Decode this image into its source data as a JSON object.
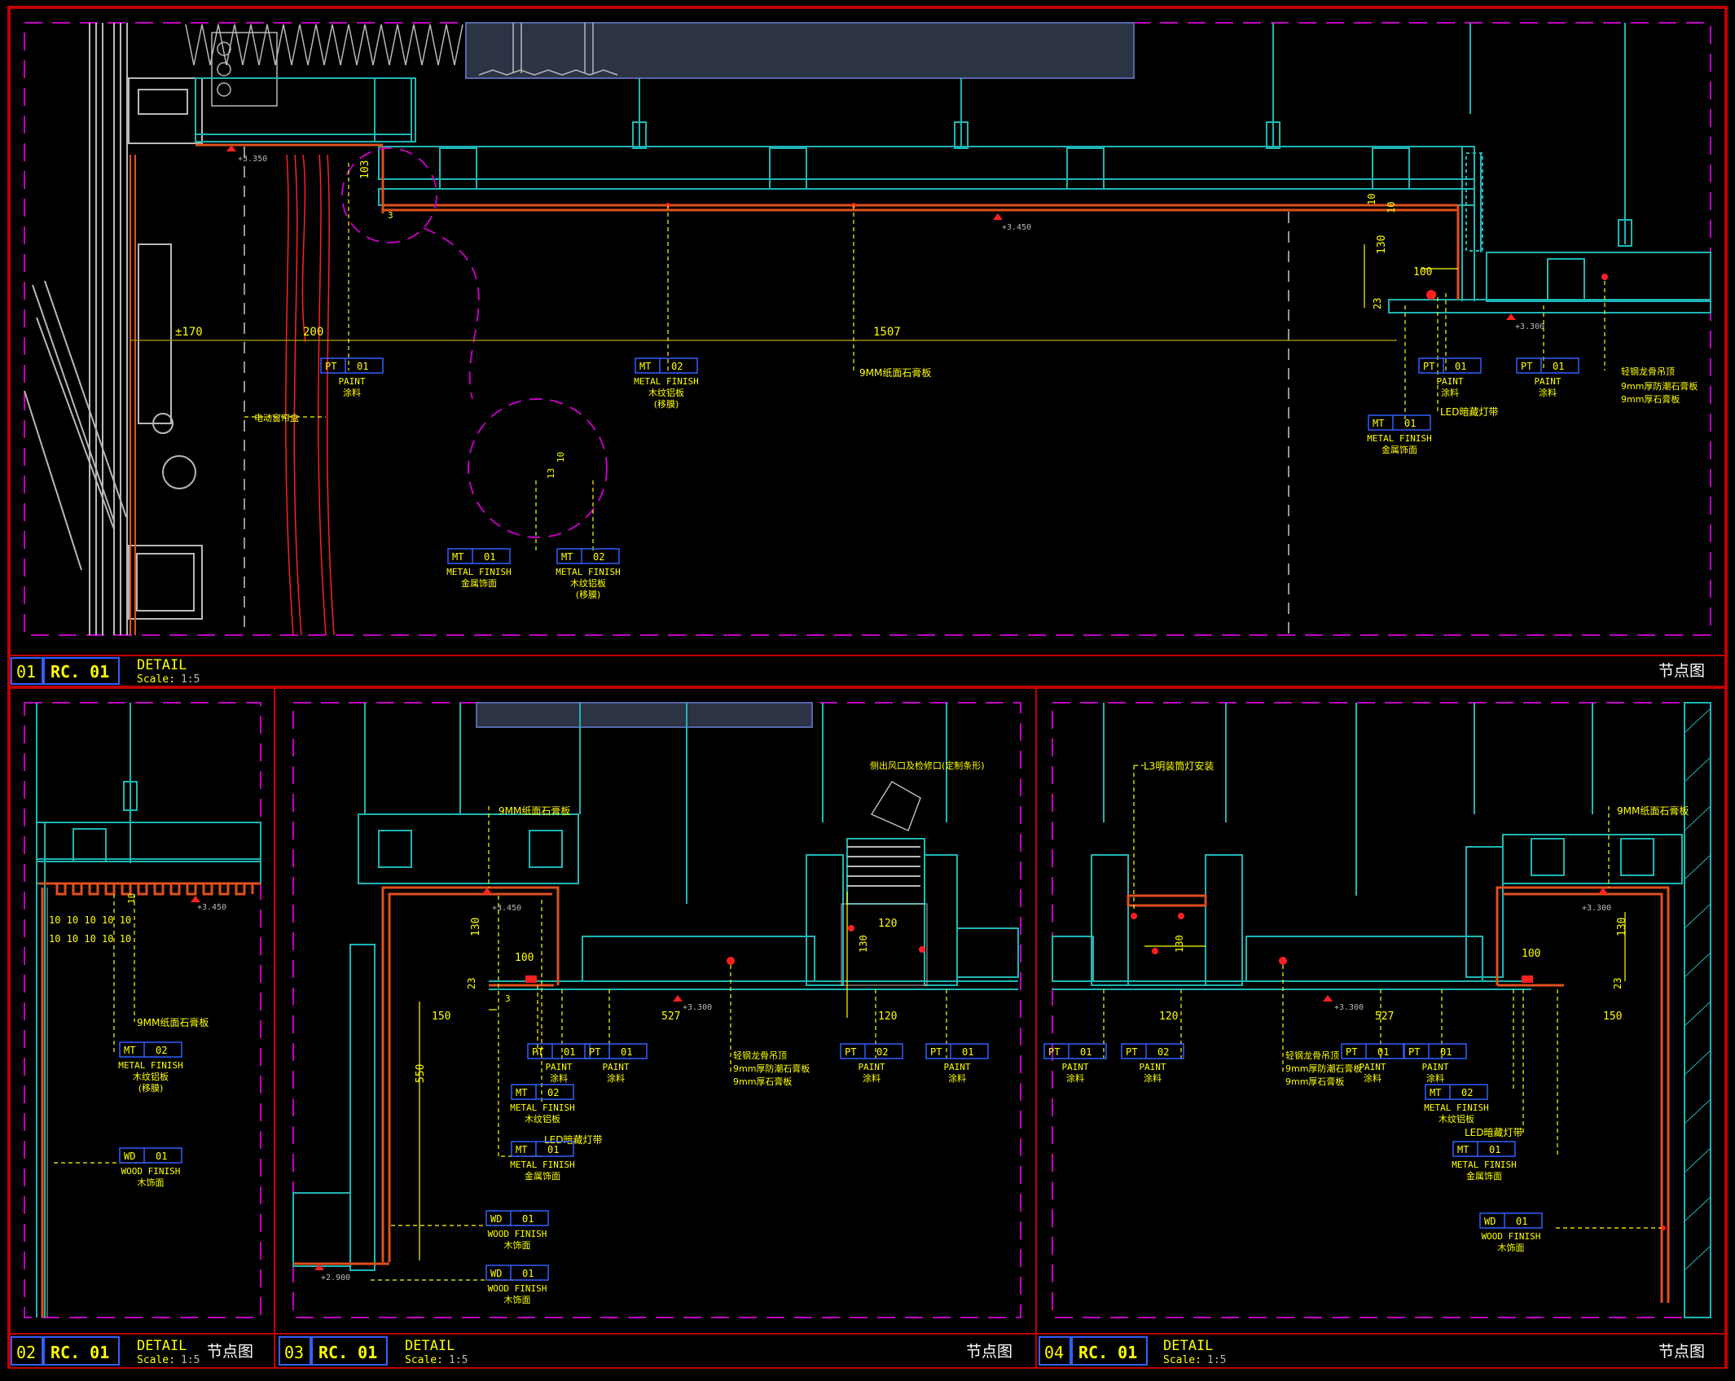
{
  "colors": {
    "background": "#000000",
    "frame": "#c00000",
    "viewport": "#c000c0",
    "structure": "#1fb5b5",
    "annotation": "#ffff00",
    "finish": "#e0501c",
    "marker": "#ff2020",
    "tag_box": "#3060ff",
    "gray": "#b8b8b8",
    "duct": "#2b3345"
  },
  "details": [
    {
      "number": "01",
      "ref": "RC. 01",
      "title": "DETAIL",
      "scale_label": "Scale:",
      "scale": "1:5",
      "name": "节点图"
    },
    {
      "number": "02",
      "ref": "RC. 01",
      "title": "DETAIL",
      "scale_label": "Scale:",
      "scale": "1:5",
      "name": "节点图"
    },
    {
      "number": "03",
      "ref": "RC. 01",
      "title": "DETAIL",
      "scale_label": "Scale:",
      "scale": "1:5",
      "name": "节点图"
    },
    {
      "number": "04",
      "ref": "RC. 01",
      "title": "DETAIL",
      "scale_label": "Scale:",
      "scale": "1:5",
      "name": "节点图"
    }
  ],
  "d1": {
    "dims": {
      "a": "±170",
      "b": "200",
      "c": "1507",
      "h103": "103",
      "h10a": "10",
      "h10b": "10",
      "h130": "130",
      "w100": "100",
      "h23": "23",
      "h3": "3",
      "c10": "10",
      "c13": "13"
    },
    "levels": {
      "l1": "+3.350",
      "l2": "+3.450",
      "l3": "+3.300"
    },
    "notes": {
      "curtain": "电动窗帘盒",
      "board": "9MM纸面石膏板",
      "led": "LED暗藏灯带",
      "n1": "轻钢龙骨吊顶",
      "n2": "9mm厚防潮石膏板",
      "n3": "9mm厚石膏板"
    },
    "tags": [
      {
        "code": "PT",
        "num": "01",
        "en": "PAINT",
        "zh": "涂料"
      },
      {
        "code": "MT",
        "num": "02",
        "en": "METAL FINISH",
        "zh": "木纹铝板",
        "zh2": "(移膜)"
      },
      {
        "code": "PT",
        "num": "01",
        "en": "PAINT",
        "zh": "涂料"
      },
      {
        "code": "PT",
        "num": "01",
        "en": "PAINT",
        "zh": "涂料"
      },
      {
        "code": "MT",
        "num": "01",
        "en": "METAL FINISH",
        "zh": "金属饰面"
      },
      {
        "code": "MT",
        "num": "01",
        "en": "METAL FINISH",
        "zh": "金属饰面"
      },
      {
        "code": "MT",
        "num": "02",
        "en": "METAL FINISH",
        "zh": "木纹铝板",
        "zh2": "(移膜)"
      }
    ]
  },
  "d2": {
    "dims": {
      "fins_top": "10 10 10 10 10",
      "fins_bot": "10 10 10 10 10",
      "h10": "10"
    },
    "levels": {
      "l1": "+3.450"
    },
    "notes": {
      "board": "9MM纸面石膏板"
    },
    "tags": [
      {
        "code": "MT",
        "num": "02",
        "en": "METAL FINISH",
        "zh": "木纹铝板",
        "zh2": "(移膜)"
      },
      {
        "code": "WD",
        "num": "01",
        "en": "WOOD FINISH",
        "zh": "木饰面"
      }
    ]
  },
  "d3": {
    "dims": {
      "h130": "130",
      "w100": "100",
      "h23": "23",
      "w150": "150",
      "w527": "527",
      "w120a": "120",
      "w120b": "120",
      "h550": "550",
      "h130b": "130",
      "h3": "3"
    },
    "levels": {
      "l1": "+3.450",
      "l2": "+3.300",
      "l3": "+2.900"
    },
    "notes": {
      "board": "9MM纸面石膏板",
      "ac": "侧出风口及检修口(定制条形)",
      "led": "LED暗藏灯带",
      "n1": "轻钢龙骨吊顶",
      "n2": "9mm厚防潮石膏板",
      "n3": "9mm厚石膏板"
    },
    "tags": [
      {
        "code": "PT",
        "num": "01",
        "en": "PAINT",
        "zh": "涂料"
      },
      {
        "code": "PT",
        "num": "01",
        "en": "PAINT",
        "zh": "涂料"
      },
      {
        "code": "MT",
        "num": "02",
        "en": "METAL FINISH",
        "zh": "木纹铝板"
      },
      {
        "code": "MT",
        "num": "01",
        "en": "METAL FINISH",
        "zh": "金属饰面"
      },
      {
        "code": "WD",
        "num": "01",
        "en": "WOOD FINISH",
        "zh": "木饰面"
      },
      {
        "code": "WD",
        "num": "01",
        "en": "WOOD FINISH",
        "zh": "木饰面"
      },
      {
        "code": "PT",
        "num": "02",
        "en": "PAINT",
        "zh": "涂料"
      },
      {
        "code": "PT",
        "num": "01",
        "en": "PAINT",
        "zh": "涂料"
      }
    ]
  },
  "d4": {
    "dims": {
      "h130": "130",
      "w120": "120",
      "w527": "527",
      "w100": "100",
      "h130b": "130",
      "h23": "23",
      "w150": "150"
    },
    "levels": {
      "l1": "+3.300",
      "l2": "+3.300"
    },
    "notes": {
      "l3": "L3明装筒灯安装",
      "board": "9MM纸面石膏板",
      "n1": "轻钢龙骨吊顶",
      "n2": "9mm厚防潮石膏板",
      "n3": "9mm厚石膏板",
      "led": "LED暗藏灯带"
    },
    "tags": [
      {
        "code": "PT",
        "num": "01",
        "en": "PAINT",
        "zh": "涂料"
      },
      {
        "code": "PT",
        "num": "02",
        "en": "PAINT",
        "zh": "涂料"
      },
      {
        "code": "PT",
        "num": "01",
        "en": "PAINT",
        "zh": "涂料"
      },
      {
        "code": "PT",
        "num": "01",
        "en": "PAINT",
        "zh": "涂料"
      },
      {
        "code": "MT",
        "num": "02",
        "en": "METAL FINISH",
        "zh": "木纹铝板"
      },
      {
        "code": "MT",
        "num": "01",
        "en": "METAL FINISH",
        "zh": "金属饰面"
      },
      {
        "code": "WD",
        "num": "01",
        "en": "WOOD FINISH",
        "zh": "木饰面"
      }
    ]
  }
}
